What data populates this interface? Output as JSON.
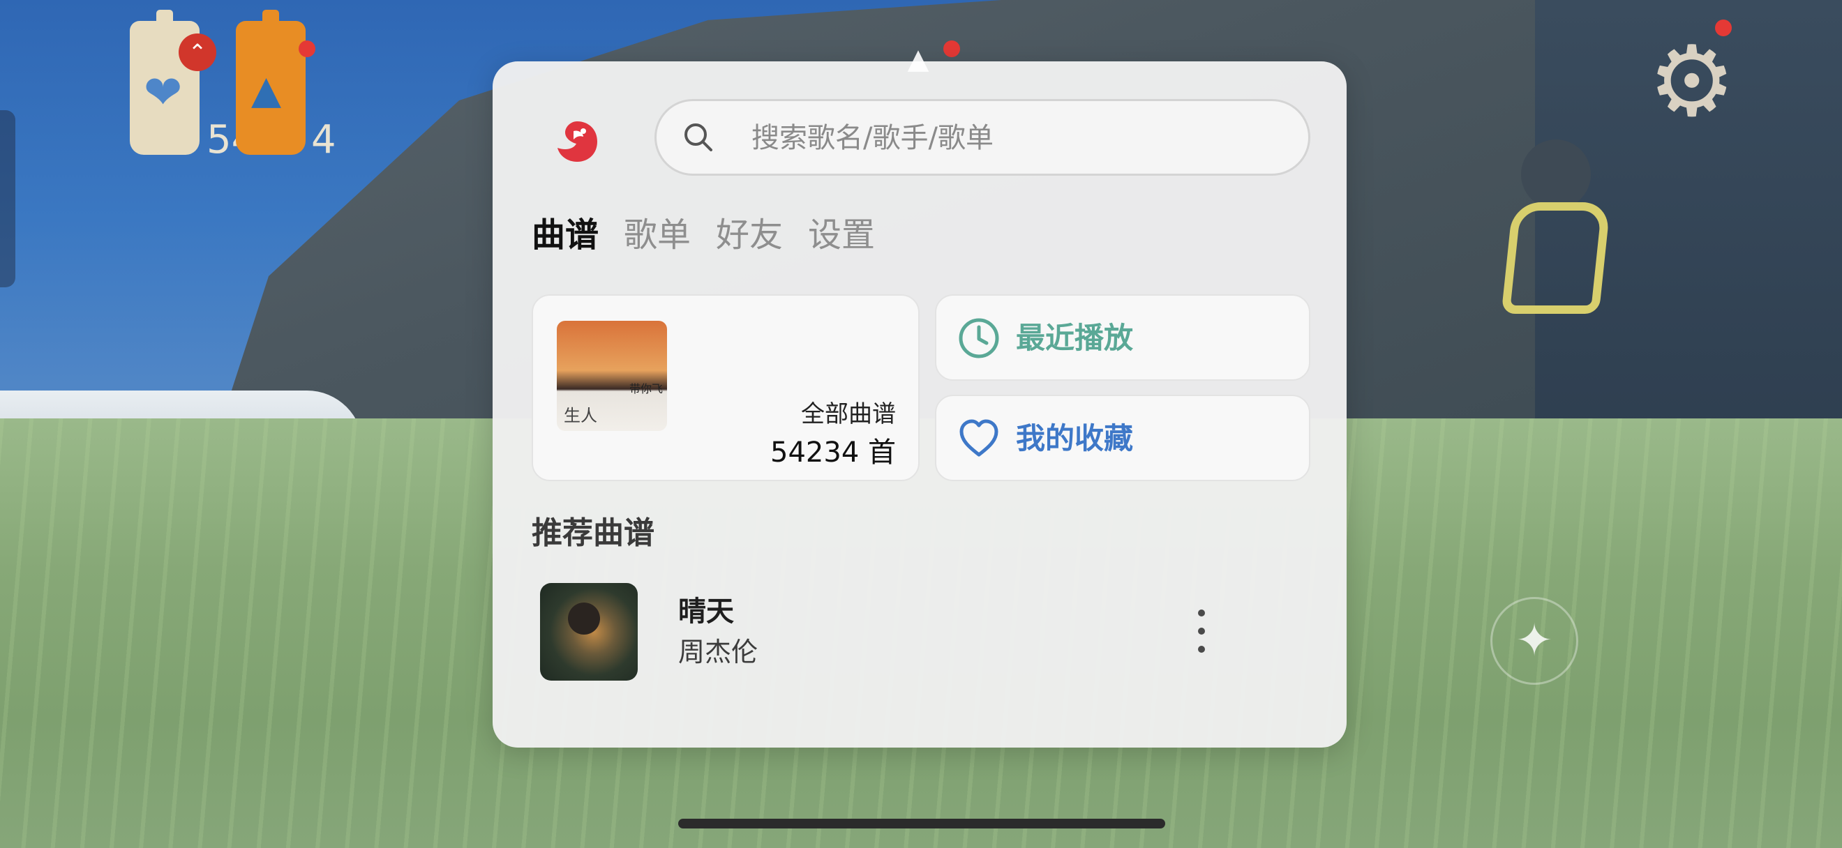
{
  "hud": {
    "count_heart": "54",
    "count_ship": "4"
  },
  "search": {
    "placeholder": "搜索歌名/歌手/歌单",
    "value": ""
  },
  "tabs": [
    {
      "label": "曲谱",
      "active": true
    },
    {
      "label": "歌单",
      "active": false
    },
    {
      "label": "好友",
      "active": false
    },
    {
      "label": "设置",
      "active": false
    }
  ],
  "all_scores": {
    "label": "全部曲谱",
    "count": "54234 首",
    "cover_text": "带你飞",
    "cover_script": "生人"
  },
  "recent": {
    "label": "最近播放"
  },
  "favorites": {
    "label": "我的收藏"
  },
  "recommended": {
    "title": "推荐曲谱",
    "songs": [
      {
        "title": "晴天",
        "artist": "周杰伦"
      }
    ]
  },
  "colors": {
    "accent_recent": "#5aa896",
    "accent_favorite": "#3e78c8",
    "logo": "#e0353f",
    "notification": "#e53935"
  },
  "icons": {
    "logo": "fish-logo-icon",
    "search": "search-icon",
    "recent": "clock-icon",
    "favorite": "heart-icon",
    "more": "more-vertical-icon",
    "settings": "gear-icon",
    "sparkle": "sparkle-icon"
  }
}
